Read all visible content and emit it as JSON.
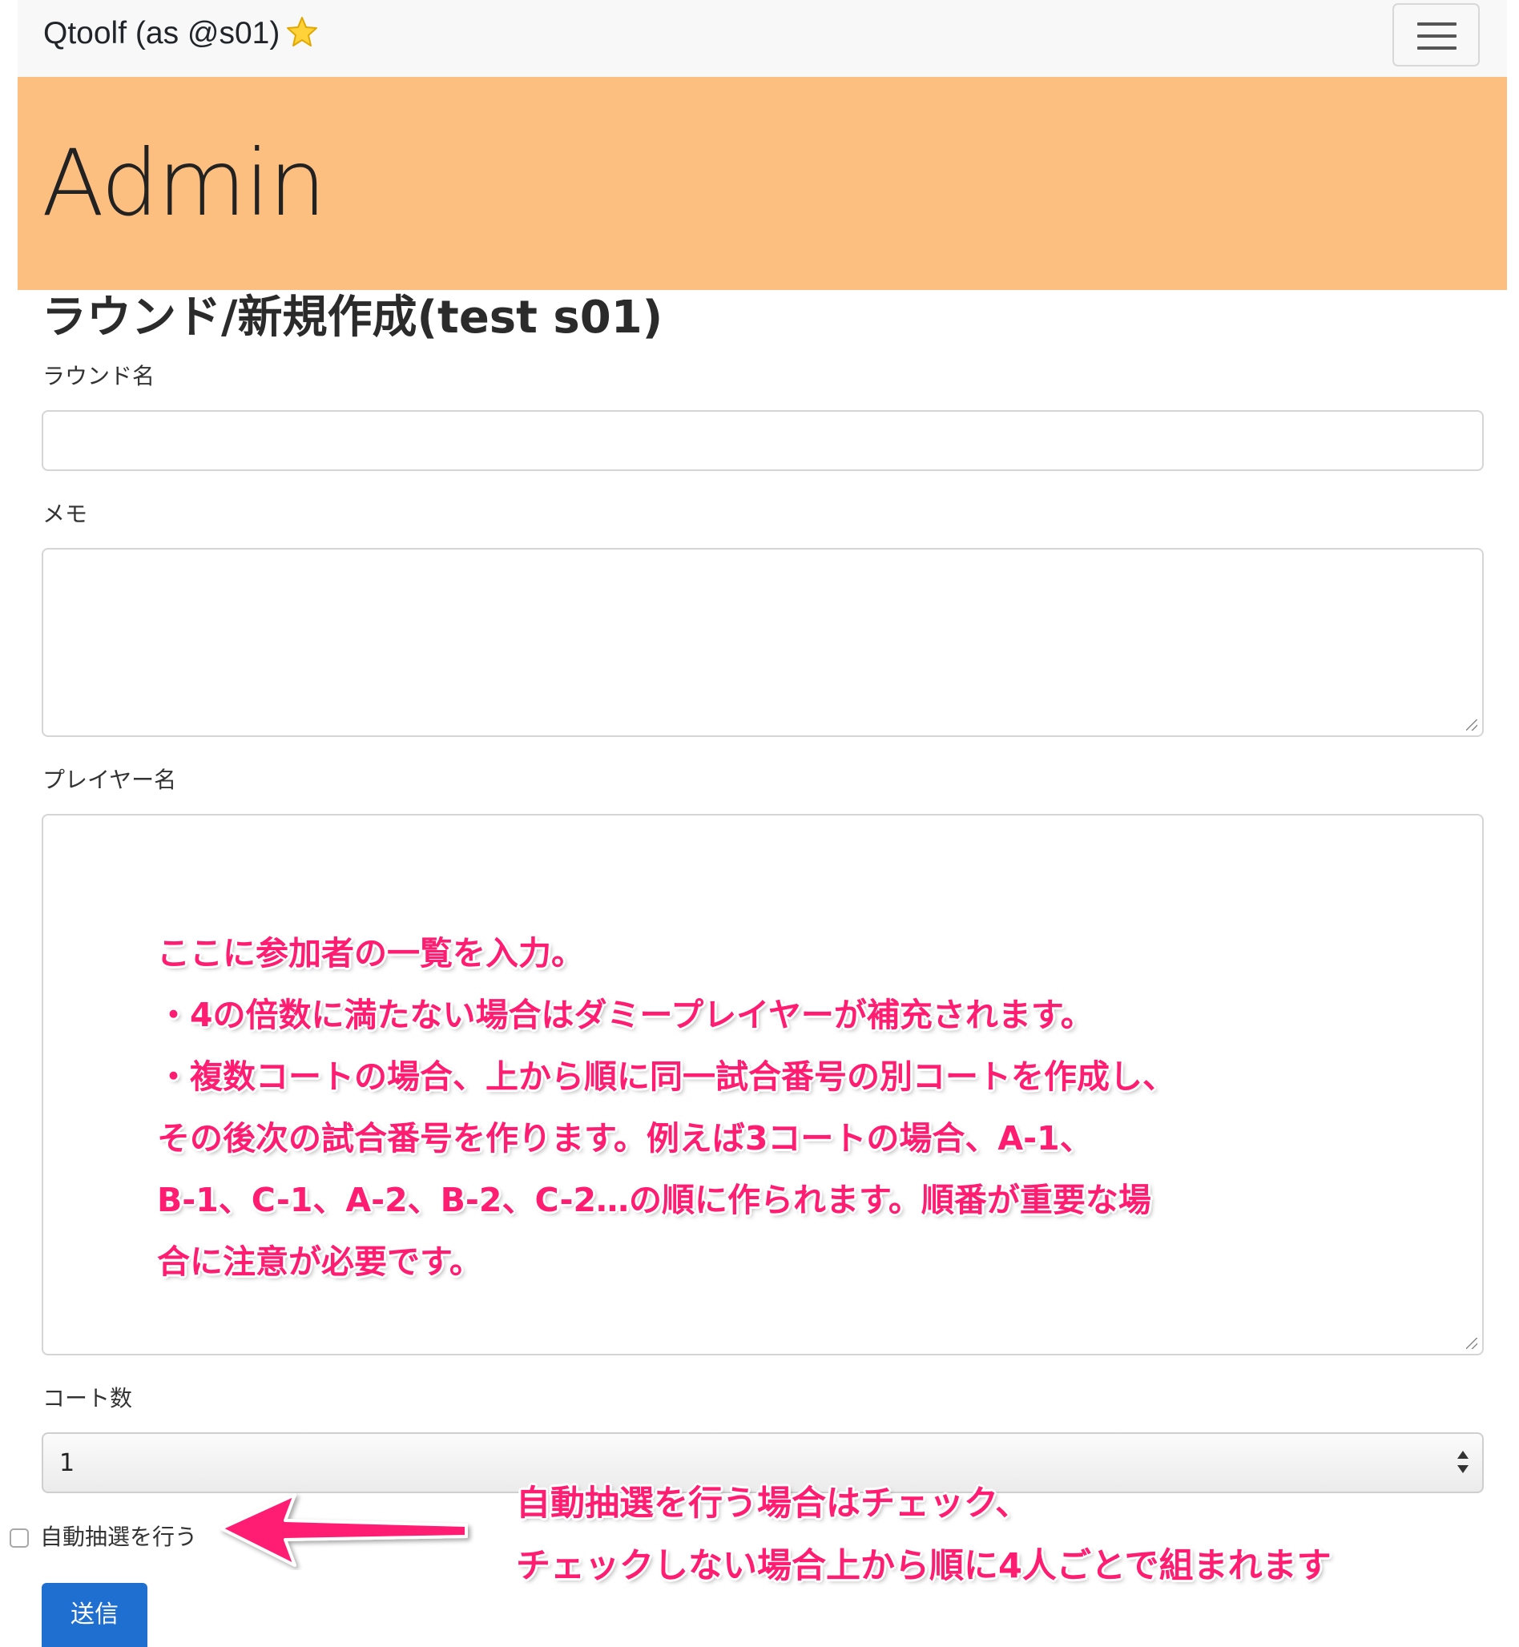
{
  "navbar": {
    "brand": "Qtoolf (as @s01)",
    "brand_icon": "star-icon",
    "menu_icon": "hamburger-menu-icon"
  },
  "jumbotron": {
    "title": "Admin",
    "background": "#fdbf80"
  },
  "page": {
    "heading": "ラウンド/新規作成(test s01)"
  },
  "form": {
    "round_name": {
      "label": "ラウンド名",
      "value": ""
    },
    "memo": {
      "label": "メモ",
      "value": ""
    },
    "players": {
      "label": "プレイヤー名",
      "value": ""
    },
    "courts": {
      "label": "コート数",
      "value": "1"
    },
    "auto_draw": {
      "label": "自動抽選を行う",
      "checked": false
    },
    "submit_label": "送信"
  },
  "annotations": {
    "players_note": [
      "ここに参加者の一覧を入力。",
      "・4の倍数に満たない場合はダミープレイヤーが補充されます。",
      "・複数コートの場合、上から順に同一試合番号の別コートを作成し、",
      "その後次の試合番号を作ります。例えば3コートの場合、A-1、",
      "B-1、C-1、A-2、B-2、C-2…の順に作られます。順番が重要な場",
      "合に注意が必要です。"
    ],
    "auto_draw_note": [
      "自動抽選を行う場合はチェック、",
      "チェックしない場合上から順に4人ごとで組まれます"
    ],
    "color": "#ff1d72"
  },
  "colors": {
    "navbar_bg": "#f8f8f8",
    "submit_bg": "#1f6fd1"
  }
}
